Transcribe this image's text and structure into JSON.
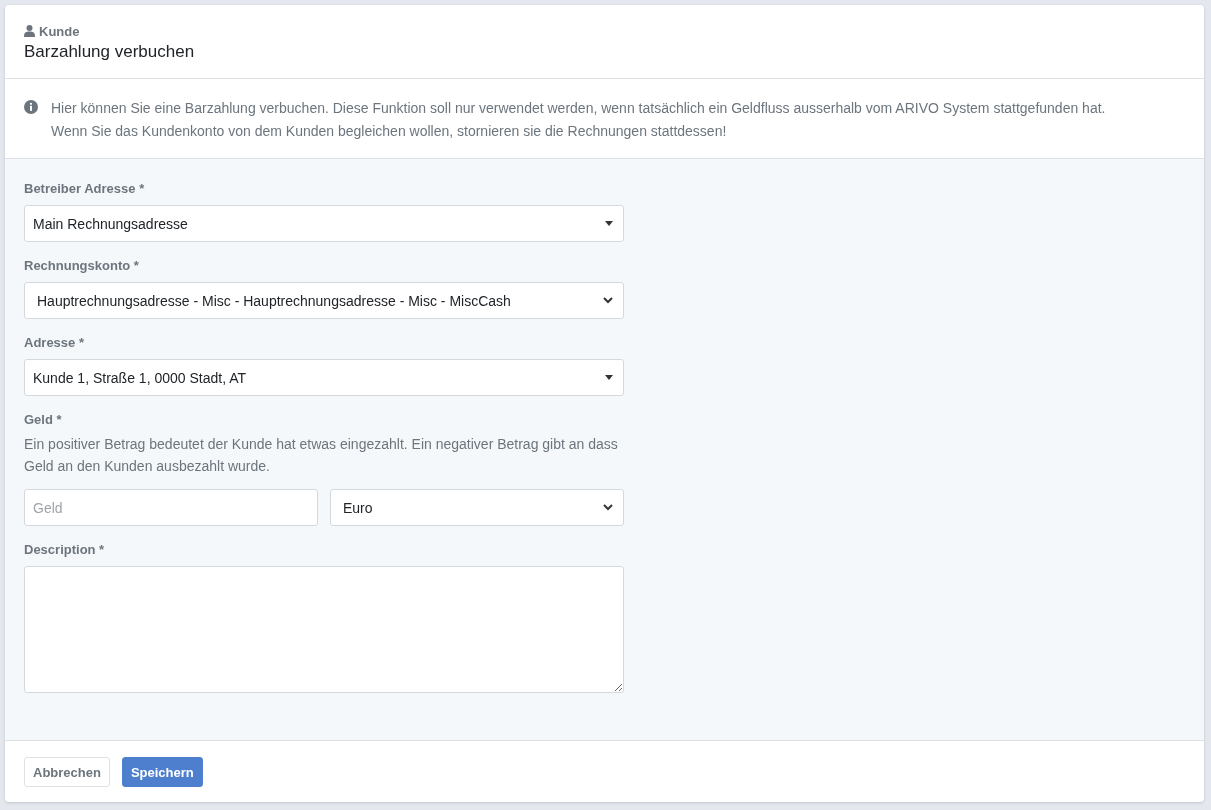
{
  "header": {
    "context": "Kunde",
    "title": "Barzahlung verbuchen"
  },
  "info": {
    "lines": [
      "Hier können Sie eine Barzahlung verbuchen. Diese Funktion soll nur verwendet werden, wenn tatsächlich ein Geldfluss ausserhalb vom ARIVO System stattgefunden hat.",
      "Wenn Sie das Kundenkonto von dem Kunden begleichen wollen, stornieren sie die Rechnungen stattdessen!"
    ]
  },
  "fields": [
    {
      "kind": "search-select",
      "label": "Betreiber Adresse *",
      "value": "Main Rechnungsadresse"
    },
    {
      "kind": "select",
      "label": "Rechnungskonto *",
      "value": "Hauptrechnungsadresse - Misc - Hauptrechnungsadresse - Misc - MiscCash"
    },
    {
      "kind": "search-select",
      "label": "Adresse *",
      "value": "Kunde 1, Straße 1, 0000 Stadt, AT"
    },
    {
      "kind": "money",
      "label": "Geld *",
      "help": "Ein positiver Betrag bedeutet der Kunde hat etwas eingezahlt. Ein negativer Betrag gibt an dass Geld an den Kunden ausbezahlt wurde.",
      "placeholder": "Geld",
      "currency": "Euro"
    },
    {
      "kind": "textarea",
      "label": "Description *"
    }
  ],
  "buttons": [
    {
      "label": "Abbrechen",
      "kind": "secondary"
    },
    {
      "label": "Speichern",
      "kind": "primary"
    }
  ]
}
